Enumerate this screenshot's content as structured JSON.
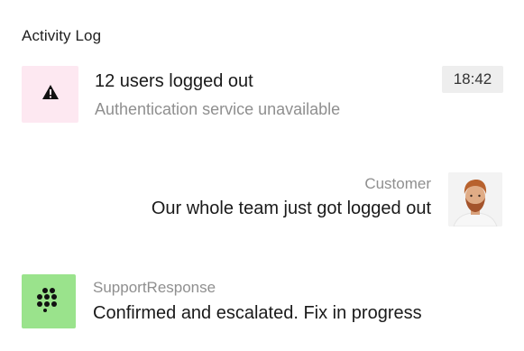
{
  "header": {
    "title": "Activity Log"
  },
  "alert": {
    "icon": "warning-icon",
    "title": "12 users logged out",
    "subtitle": "Authentication service unavailable",
    "time": "18:42",
    "icon_bg": "#fde8f1"
  },
  "customer": {
    "label": "Customer",
    "message": "Our whole team just got logged out",
    "avatar": "avatar-customer"
  },
  "support": {
    "icon": "dots-grid-icon",
    "label": "SupportResponse",
    "message": "Confirmed and escalated. Fix in progress",
    "icon_bg": "#9ae38c"
  }
}
